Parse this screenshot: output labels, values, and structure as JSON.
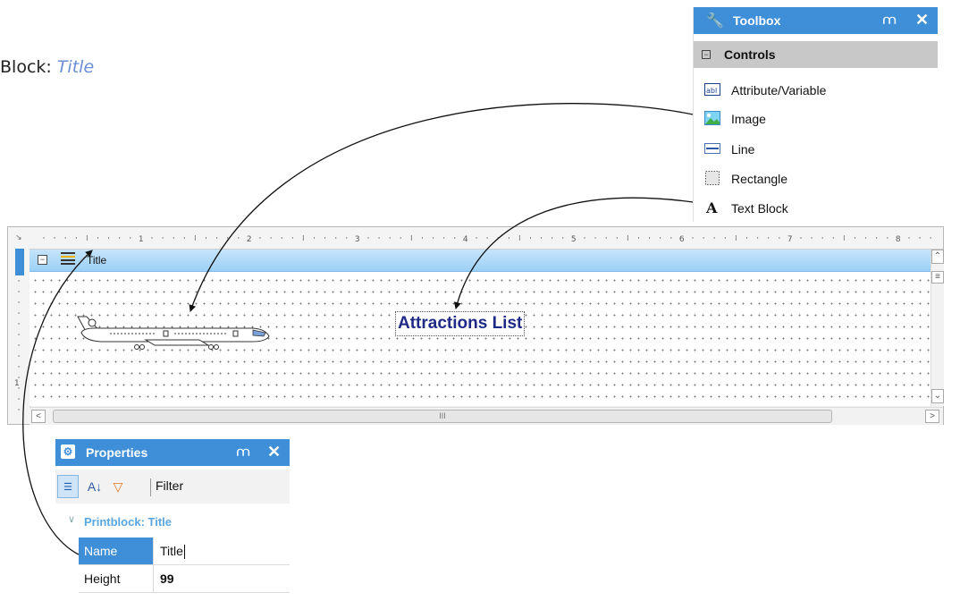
{
  "heading": {
    "prefix": "Block: ",
    "title": "Title"
  },
  "toolbox": {
    "title": "Toolbox",
    "pin_icon": "pin-icon",
    "close_icon": "close-icon",
    "category": "Controls",
    "items": [
      {
        "label": "Attribute/Variable",
        "icon": "attribute-icon"
      },
      {
        "label": "Image",
        "icon": "image-icon"
      },
      {
        "label": "Line",
        "icon": "line-icon"
      },
      {
        "label": "Rectangle",
        "icon": "rectangle-icon"
      },
      {
        "label": "Text Block",
        "icon": "text-block-icon"
      }
    ]
  },
  "editor": {
    "ruler_numbers": [
      "1",
      "2",
      "3",
      "4",
      "5",
      "6",
      "7",
      "8"
    ],
    "left_ruler_number": "1",
    "band_label": "Title",
    "text_block": "Attractions List",
    "scroll_thumb_grip": "III"
  },
  "properties": {
    "title": "Properties",
    "filter_label": "Filter",
    "group_label": "Printblock: Title",
    "rows": [
      {
        "key": "Name",
        "value": "Title"
      },
      {
        "key": "Height",
        "value": "99"
      }
    ]
  },
  "colors": {
    "accent": "#3f8fd8",
    "band": "#9dd0f7",
    "text_block": "#1f2a86",
    "italic_title": "#6a8fd6"
  }
}
